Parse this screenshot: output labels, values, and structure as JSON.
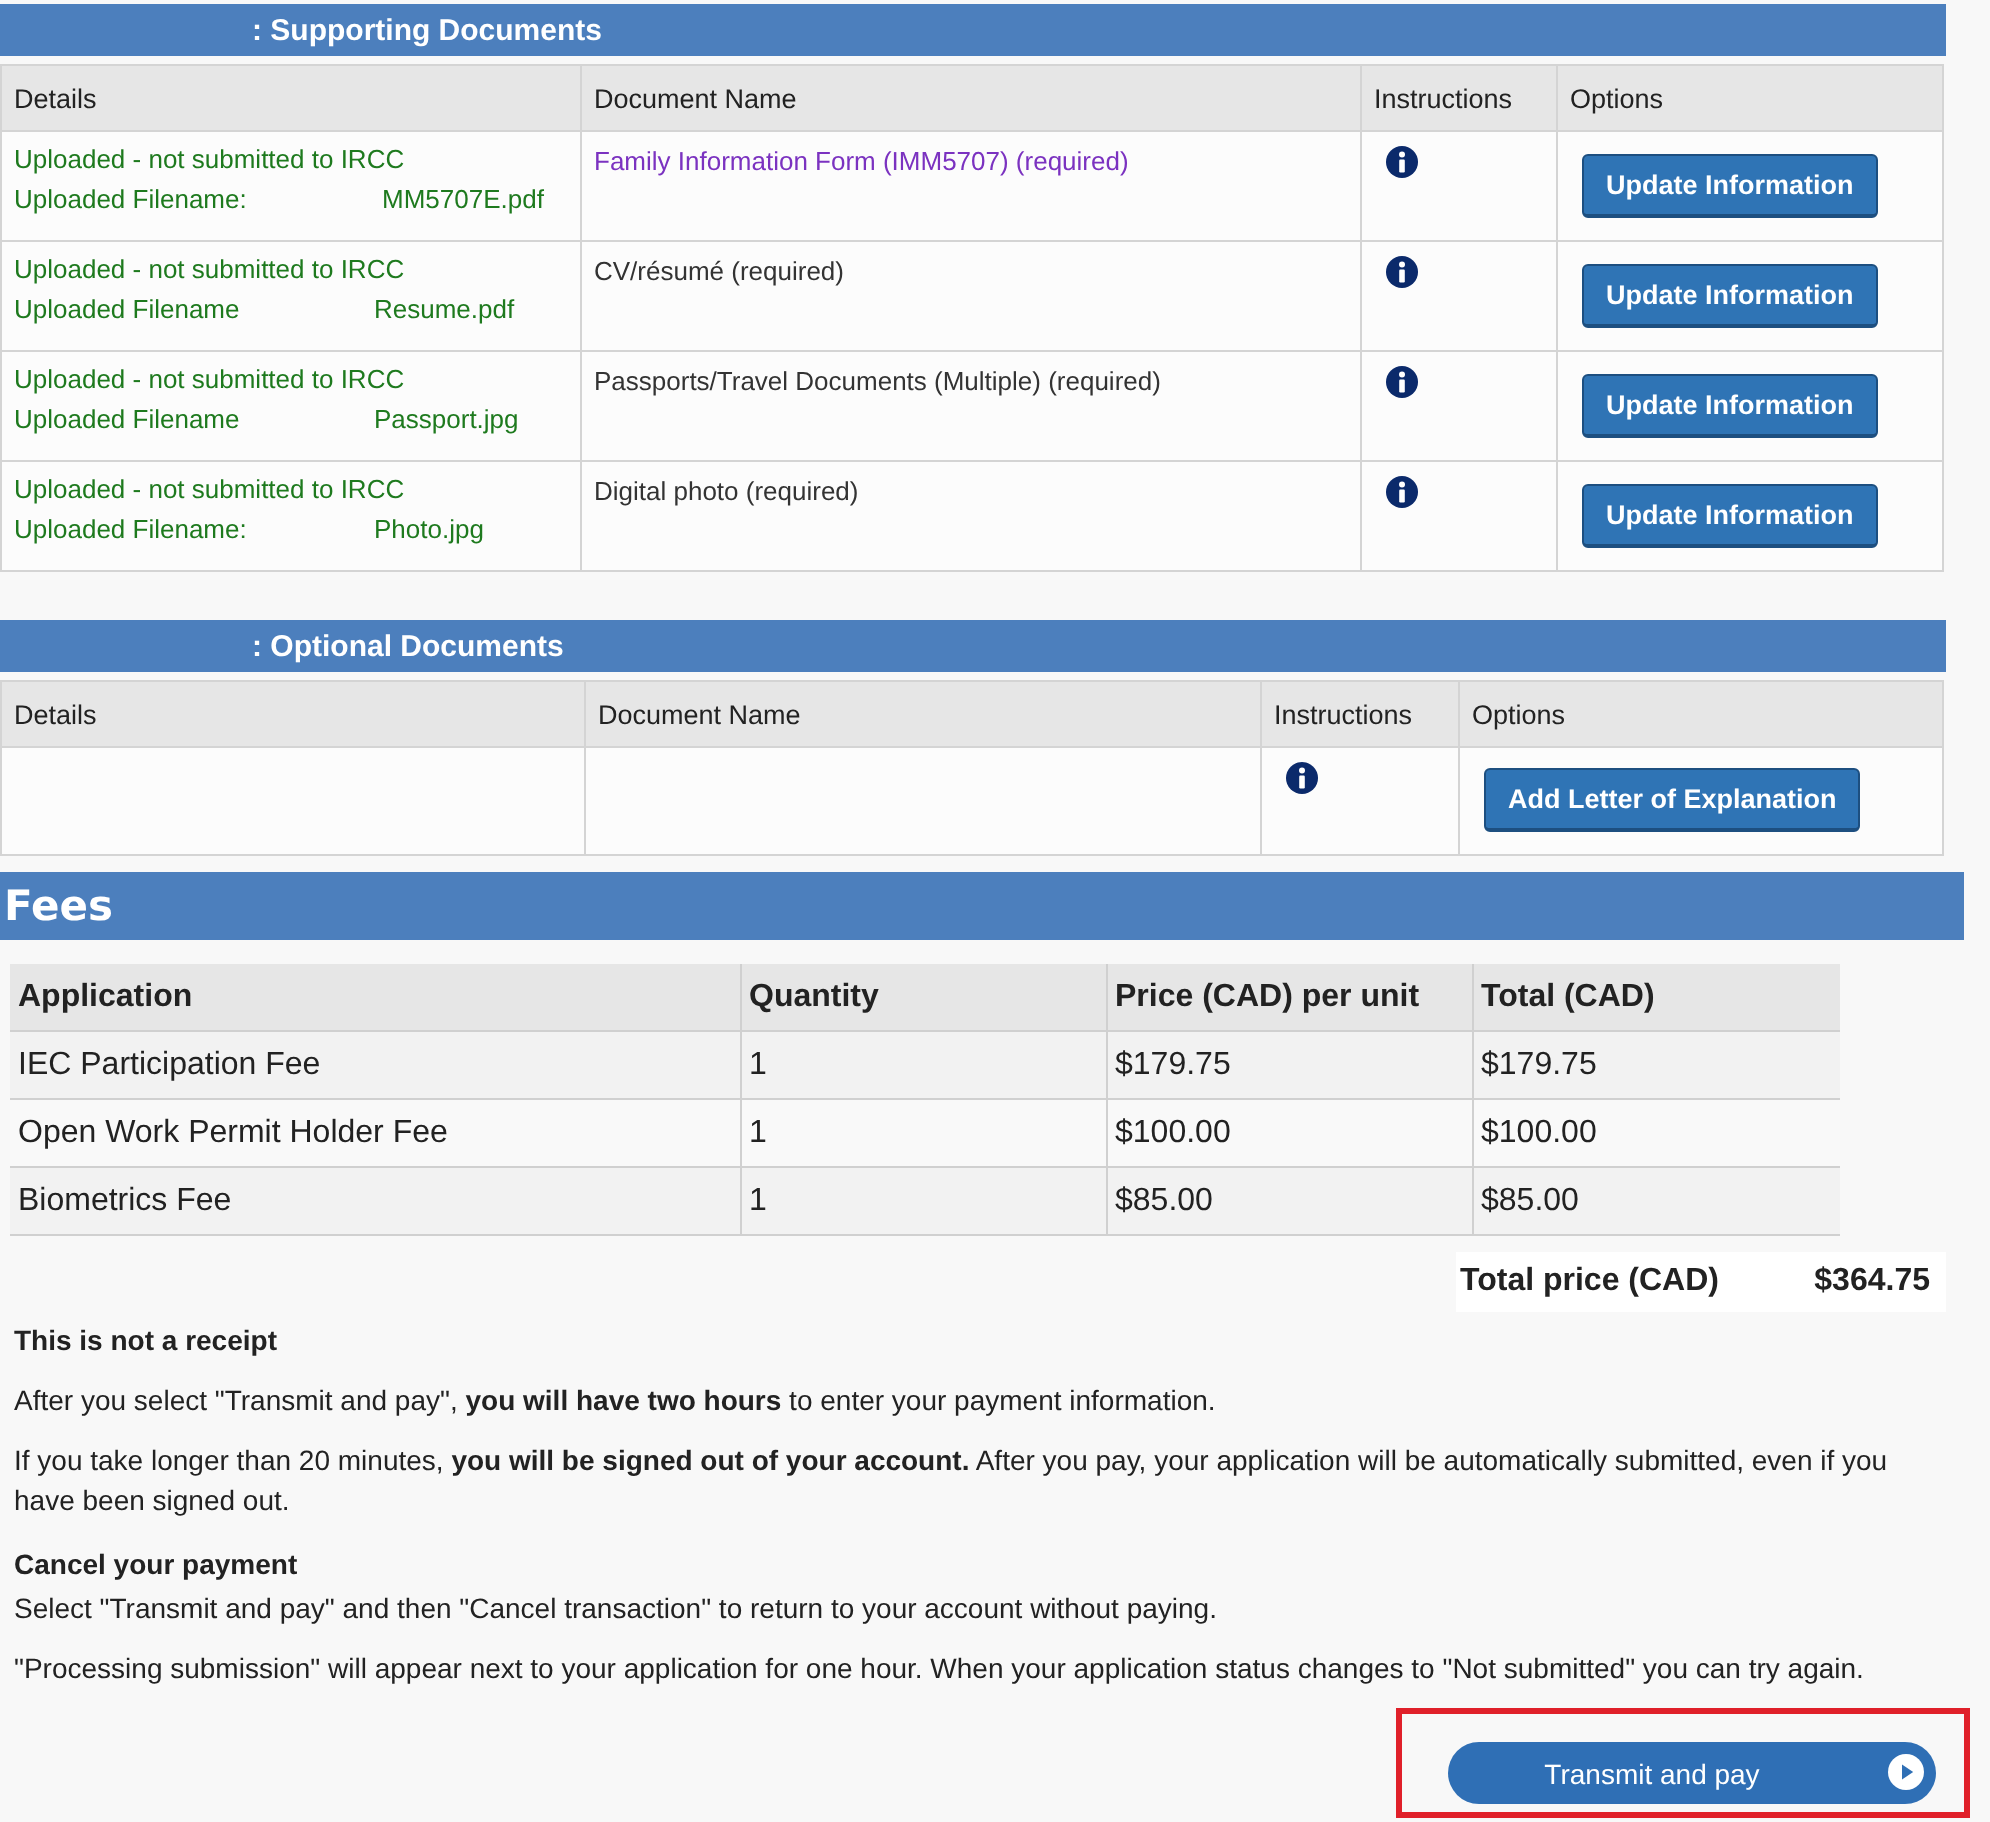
{
  "supporting": {
    "title": ": Supporting Documents",
    "columns": [
      "Details",
      "Document Name",
      "Instructions",
      "Options"
    ],
    "rows": [
      {
        "status": "Uploaded - not submitted to IRCC",
        "filename_label": "Uploaded Filename:",
        "filename": "MM5707E.pdf",
        "document": "Family Information Form (IMM5707)  (required)",
        "kind": "link",
        "button": "Update Information"
      },
      {
        "status": "Uploaded - not submitted to IRCC",
        "filename_label": "Uploaded Filename",
        "filename": "Resume.pdf",
        "document": "CV/résumé  (required)",
        "kind": "plain",
        "button": "Update Information"
      },
      {
        "status": "Uploaded - not submitted to IRCC",
        "filename_label": "Uploaded Filename",
        "filename": "Passport.jpg",
        "document": "Passports/Travel Documents (Multiple)  (required)",
        "kind": "plain",
        "button": "Update Information"
      },
      {
        "status": "Uploaded - not submitted to IRCC",
        "filename_label": "Uploaded Filename:",
        "filename": "Photo.jpg",
        "document": "Digital photo  (required)",
        "kind": "plain",
        "button": "Update Information"
      }
    ]
  },
  "optional": {
    "title": ": Optional Documents",
    "columns": [
      "Details",
      "Document Name",
      "Instructions",
      "Options"
    ],
    "button": "Add Letter of Explanation"
  },
  "fees": {
    "title": "Fees",
    "columns": [
      "Application",
      "Quantity",
      "Price (CAD) per unit",
      "Total (CAD)"
    ],
    "rows": [
      [
        "IEC Participation Fee",
        "1",
        "$179.75",
        "$179.75"
      ],
      [
        "Open Work Permit Holder Fee",
        "1",
        "$100.00",
        "$100.00"
      ],
      [
        "Biometrics Fee",
        "1",
        "$85.00",
        "$85.00"
      ]
    ],
    "total_label": "Total price (CAD)",
    "total_value": "$364.75"
  },
  "notice": {
    "heading": "This is not a receipt",
    "paragraph_1": "After you select \"Transmit and pay\", **you will have two hours** to enter your payment information.",
    "paragraph_2": "If you take longer than 20 minutes, **you will be signed out of your account.** After you pay, your application will be automatically submitted, even if you have been signed out.",
    "cancel_heading": "Cancel your payment",
    "paragraph_3": "Select \"Transmit and pay\" and then \"Cancel transaction\" to return to your account without paying.",
    "paragraph_4": "\"Processing submission\" will appear next to your application for one hour. When your application status changes to \"Not submitted\" you can try again."
  },
  "transmit_button": {
    "label": "Transmit and pay",
    "highlighted": true
  }
}
